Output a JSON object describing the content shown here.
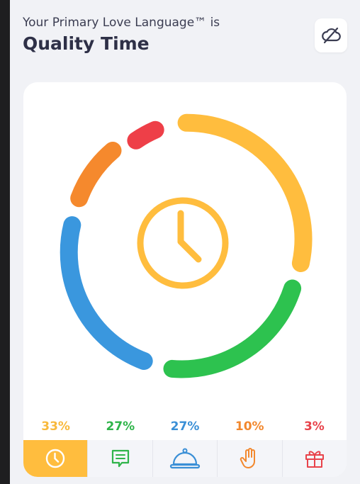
{
  "header": {
    "subtitle": "Your Primary Love Language™ is",
    "title": "Quality Time"
  },
  "colors": {
    "quality_time": "#ffbd3e",
    "words": "#2dc24f",
    "service": "#3a97de",
    "touch": "#f5892d",
    "gifts": "#ee3f48"
  },
  "languages": [
    {
      "key": "quality-time",
      "percent_label": "33%",
      "percent": 33,
      "color": "#f8b93c",
      "icon": "clock-icon"
    },
    {
      "key": "words-of-affirmation",
      "percent_label": "27%",
      "percent": 27,
      "color": "#2fb44a",
      "icon": "speech-bubble-icon"
    },
    {
      "key": "acts-of-service",
      "percent_label": "27%",
      "percent": 27,
      "color": "#3a8fd6",
      "icon": "service-bell-icon"
    },
    {
      "key": "physical-touch",
      "percent_label": "10%",
      "percent": 10,
      "color": "#f2882e",
      "icon": "hand-icon"
    },
    {
      "key": "receiving-gifts",
      "percent_label": "3%",
      "percent": 3,
      "color": "#e8434b",
      "icon": "gift-icon"
    }
  ],
  "active_tab": "quality-time",
  "center_icon": "clock-icon"
}
